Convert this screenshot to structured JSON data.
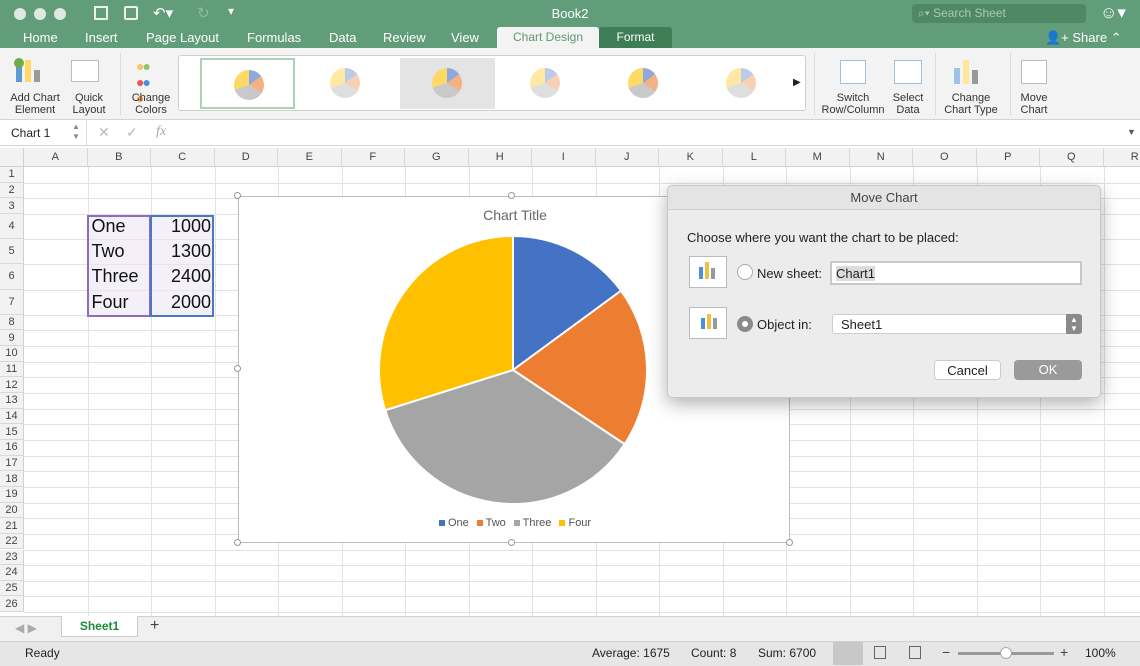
{
  "window": {
    "title": "Book2",
    "search_placeholder": "Search Sheet"
  },
  "tabs": [
    "Home",
    "Insert",
    "Page Layout",
    "Formulas",
    "Data",
    "Review",
    "View",
    "Chart Design",
    "Format"
  ],
  "active_tab": "Chart Design",
  "share_label": "Share",
  "ribbon": {
    "add_chart_element": [
      "Add Chart",
      "Element"
    ],
    "quick_layout": [
      "Quick",
      "Layout"
    ],
    "change_colors": [
      "Change",
      "Colors"
    ],
    "switch": [
      "Switch",
      "Row/Column"
    ],
    "select_data": [
      "Select",
      "Data"
    ],
    "change_type": [
      "Change",
      "Chart Type"
    ],
    "move_chart": [
      "Move",
      "Chart"
    ]
  },
  "formula_bar": {
    "name_box": "Chart 1",
    "fx": "fx",
    "value": ""
  },
  "columns": [
    "A",
    "B",
    "C",
    "D",
    "E",
    "F",
    "G",
    "H",
    "I",
    "J",
    "K",
    "L",
    "M",
    "N",
    "O",
    "P",
    "Q",
    "R"
  ],
  "rows": [
    "1",
    "2",
    "3",
    "4",
    "5",
    "6",
    "7",
    "8",
    "9",
    "10",
    "11",
    "12",
    "13",
    "14",
    "15",
    "16",
    "17",
    "18",
    "19",
    "20",
    "21",
    "22",
    "23",
    "24",
    "25",
    "26"
  ],
  "cells": [
    {
      "ref": "B4",
      "value": "One"
    },
    {
      "ref": "C4",
      "value": "1000"
    },
    {
      "ref": "B5",
      "value": "Two"
    },
    {
      "ref": "C5",
      "value": "1300"
    },
    {
      "ref": "B6",
      "value": "Three"
    },
    {
      "ref": "C6",
      "value": "2400"
    },
    {
      "ref": "B7",
      "value": "Four"
    },
    {
      "ref": "C7",
      "value": "2000"
    }
  ],
  "chart_data": {
    "type": "pie",
    "title": "Chart Title",
    "categories": [
      "One",
      "Two",
      "Three",
      "Four"
    ],
    "values": [
      1000,
      1300,
      2400,
      2000
    ],
    "colors": [
      "#4472C4",
      "#ED7D31",
      "#A5A5A5",
      "#FFC000"
    ],
    "legend": "bottom"
  },
  "dialog": {
    "title": "Move Chart",
    "prompt": "Choose where you want the chart to be placed:",
    "new_sheet_label": "New sheet:",
    "new_sheet_value": "Chart1",
    "object_in_label": "Object in:",
    "object_in_value": "Sheet1",
    "selected": "Object in",
    "cancel": "Cancel",
    "ok": "OK"
  },
  "sheet_tabs": [
    "Sheet1"
  ],
  "status": {
    "ready": "Ready",
    "average": "Average: 1675",
    "count": "Count: 8",
    "sum": "Sum: 6700",
    "zoom": "100%",
    "zoom_level": 100
  }
}
